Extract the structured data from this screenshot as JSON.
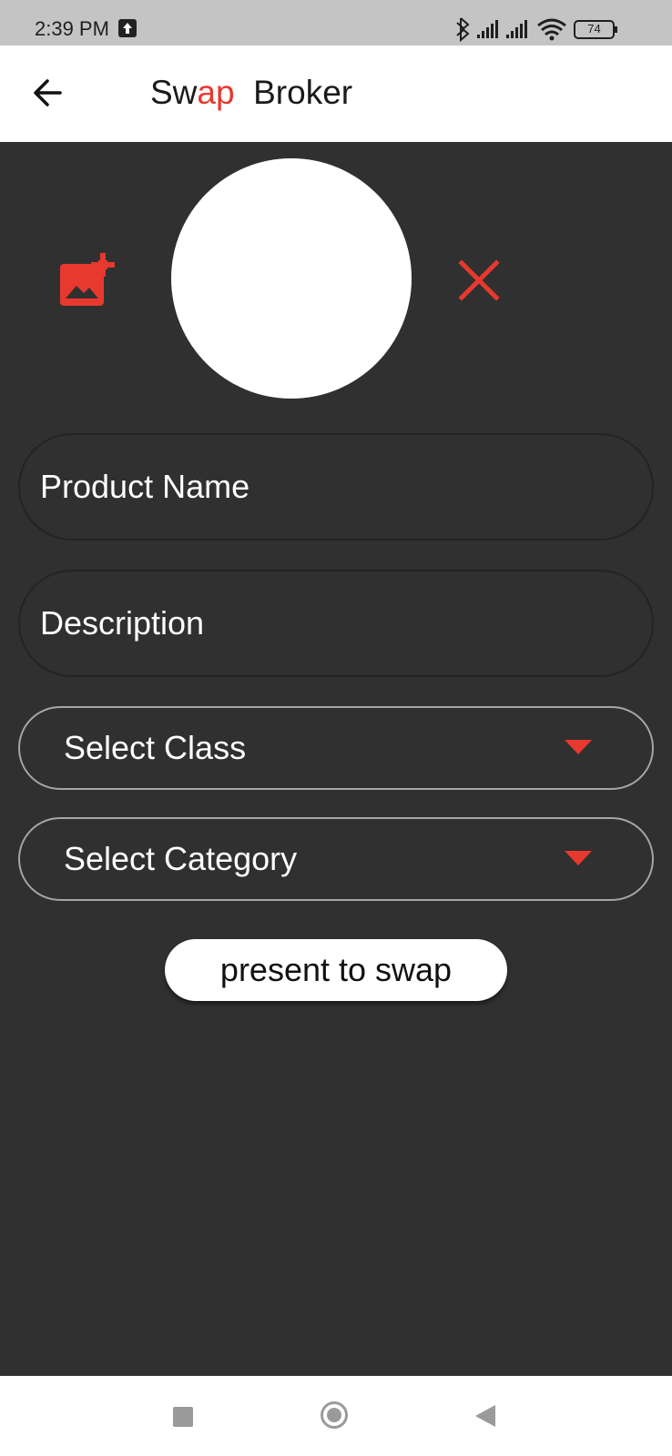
{
  "status_bar": {
    "time": "2:39 PM",
    "battery": "74",
    "icons": [
      "upload-icon",
      "bluetooth-icon",
      "signal-icon",
      "signal-icon",
      "wifi-icon",
      "battery-icon"
    ]
  },
  "app_bar": {
    "title_part1": "Sw",
    "title_accent": "ap",
    "title_part2": "  Broker",
    "back_icon": "back-arrow-icon"
  },
  "colors": {
    "accent": "#e8392e",
    "background": "#303030",
    "app_bar": "#ffffff"
  },
  "image_picker": {
    "add_icon": "add-photo-icon",
    "remove_icon": "close-icon"
  },
  "form": {
    "product_name_placeholder": "Product Name",
    "description_placeholder": "Description",
    "class_select_label": "Select Class",
    "category_select_label": "Select Category",
    "submit_label": "present to swap"
  },
  "nav_bar": {
    "icons": [
      "recents-icon",
      "home-icon",
      "back-icon"
    ]
  }
}
